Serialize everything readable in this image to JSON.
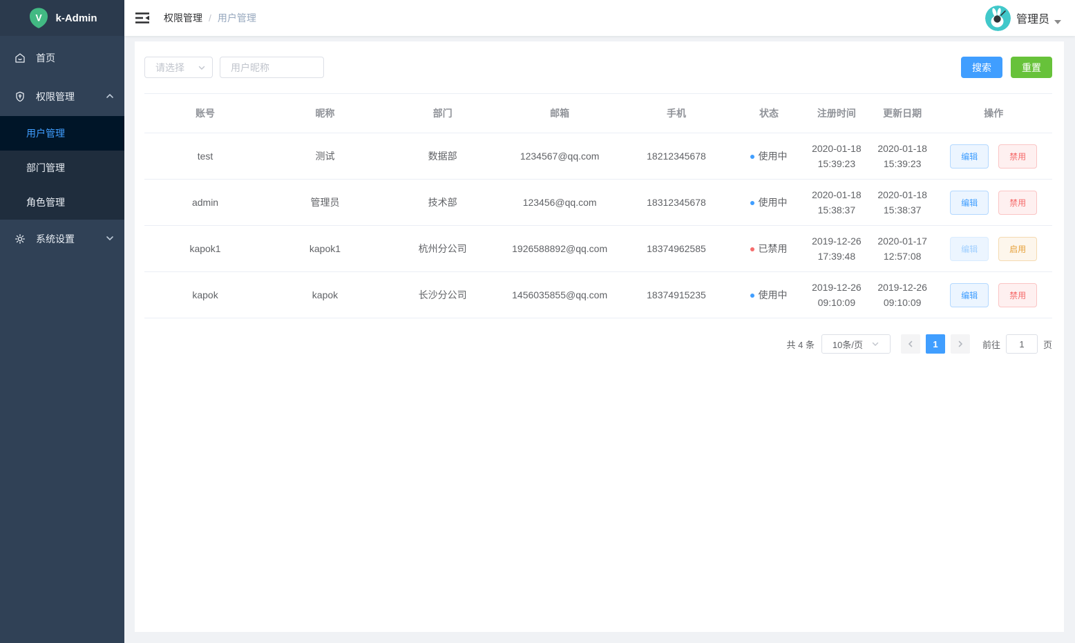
{
  "sidebar": {
    "logo_letter": "V",
    "logo_text": "k-Admin",
    "items": [
      {
        "label": "首页"
      },
      {
        "label": "权限管理"
      },
      {
        "label": "系统设置"
      }
    ],
    "submenu": [
      {
        "label": "用户管理"
      },
      {
        "label": "部门管理"
      },
      {
        "label": "角色管理"
      }
    ]
  },
  "header": {
    "breadcrumb": [
      "权限管理",
      "用户管理"
    ],
    "breadcrumb_separator": "/",
    "user_name": "管理员"
  },
  "filters": {
    "select_placeholder": "请选择",
    "input_placeholder": "用户昵称",
    "search_label": "搜索",
    "reset_label": "重置"
  },
  "table": {
    "columns": [
      "账号",
      "昵称",
      "部门",
      "邮箱",
      "手机",
      "状态",
      "注册时间",
      "更新日期",
      "操作"
    ],
    "rows": [
      {
        "account": "test",
        "nickname": "测试",
        "department": "数据部",
        "email": "1234567@qq.com",
        "phone": "18212345678",
        "status": "使用中",
        "register_time": "2020-01-18 15:39:23",
        "update_time": "2020-01-18 15:39:23",
        "edit_label": "编辑",
        "toggle_label": "禁用"
      },
      {
        "account": "admin",
        "nickname": "管理员",
        "department": "技术部",
        "email": "123456@qq.com",
        "phone": "18312345678",
        "status": "使用中",
        "register_time": "2020-01-18 15:38:37",
        "update_time": "2020-01-18 15:38:37",
        "edit_label": "编辑",
        "toggle_label": "禁用"
      },
      {
        "account": "kapok1",
        "nickname": "kapok1",
        "department": "杭州分公司",
        "email": "1926588892@qq.com",
        "phone": "18374962585",
        "status": "已禁用",
        "register_time": "2019-12-26 17:39:48",
        "update_time": "2020-01-17 12:57:08",
        "edit_label": "编辑",
        "toggle_label": "启用"
      },
      {
        "account": "kapok",
        "nickname": "kapok",
        "department": "长沙分公司",
        "email": "1456035855@qq.com",
        "phone": "18374915235",
        "status": "使用中",
        "register_time": "2019-12-26 09:10:09",
        "update_time": "2019-12-26 09:10:09",
        "edit_label": "编辑",
        "toggle_label": "禁用"
      }
    ]
  },
  "pagination": {
    "total_text": "共 4 条",
    "page_size": "10条/页",
    "current_page": "1",
    "goto_label": "前往",
    "goto_value": "1",
    "page_unit": "页"
  },
  "colors": {
    "primary": "#409eff",
    "success": "#67c23a",
    "danger": "#f56c6c",
    "warning": "#e6a23c",
    "sidebar_bg": "#304156",
    "submenu_bg": "#1f2d3d",
    "submenu_active_bg": "#001528",
    "avatar_bg": "#41c8ca",
    "logo_green": "#42b983"
  }
}
